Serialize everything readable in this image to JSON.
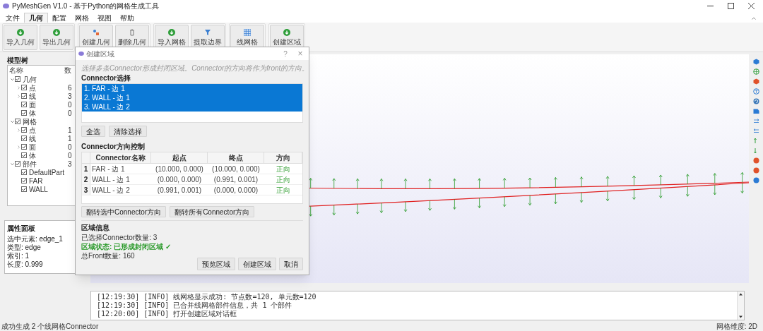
{
  "window": {
    "title": "PyMeshGen V1.0 - 基于Python的网格生成工具"
  },
  "menu": [
    {
      "label": "文件",
      "selected": false
    },
    {
      "label": "几何",
      "selected": true
    },
    {
      "label": "配置",
      "selected": false
    },
    {
      "label": "网格",
      "selected": false
    },
    {
      "label": "视图",
      "selected": false
    },
    {
      "label": "帮助",
      "selected": false
    }
  ],
  "toolbar": [
    {
      "buttons": [
        {
          "label": "导入几何",
          "kind": "import"
        },
        {
          "label": "导出几何",
          "kind": "import"
        }
      ]
    },
    {
      "buttons": [
        {
          "label": "创建几何",
          "kind": "shape"
        },
        {
          "label": "删除几何",
          "kind": "trash"
        }
      ]
    },
    {
      "buttons": [
        {
          "label": "导入网格",
          "kind": "import"
        },
        {
          "label": "提取边界",
          "kind": "filter"
        }
      ]
    },
    {
      "buttons": [
        {
          "label": "线网格",
          "kind": "grid"
        }
      ]
    },
    {
      "buttons": [
        {
          "label": "创建区域",
          "kind": "import"
        }
      ]
    }
  ],
  "model_tree": {
    "title": "模型树",
    "columns": [
      "名称",
      "数"
    ],
    "items": [
      {
        "label": "几何",
        "checked": true,
        "expanded": true,
        "children": [
          {
            "label": "点",
            "value": "6",
            "checked": true,
            "expanded": false
          },
          {
            "label": "线",
            "value": "3",
            "checked": true,
            "expanded": false
          },
          {
            "label": "面",
            "value": "0",
            "checked": true
          },
          {
            "label": "体",
            "value": "0",
            "checked": true
          }
        ]
      },
      {
        "label": "网格",
        "checked": true,
        "expanded": true,
        "children": [
          {
            "label": "点",
            "value": "1",
            "checked": true,
            "expanded": false
          },
          {
            "label": "线",
            "value": "1",
            "checked": true
          },
          {
            "label": "面",
            "value": "0",
            "checked": true,
            "expanded": false
          },
          {
            "label": "体",
            "value": "0",
            "checked": true
          }
        ]
      },
      {
        "label": "部件",
        "value": "3",
        "checked": true,
        "expanded": true,
        "children": [
          {
            "label": "DefaultPart",
            "checked": true
          },
          {
            "label": "FAR",
            "checked": true
          },
          {
            "label": "WALL",
            "checked": true
          }
        ]
      }
    ]
  },
  "properties": {
    "title": "属性面板",
    "lines": [
      "选中元素: edge_1",
      "类型: edge",
      "索引: 1",
      "长度: 0.999"
    ]
  },
  "log": {
    "lines": [
      "[12:19:30] [INFO] 线网格显示成功: 节点数=120, 单元数=120",
      "[12:19:30] [INFO] 已合并线网格部件信息，共 1 个部件",
      "[12:20:00] [INFO] 打开创建区域对话框"
    ]
  },
  "status_bar": {
    "message": "成功生成 2 个线网格Connector",
    "dimension": "网格维度: 2D"
  },
  "dialog": {
    "title": "创建区域",
    "help": "?",
    "close": "×",
    "description": "选择多条Connector形成封闭区域。Connector的方向将作为front的方向。",
    "selection_title": "Connector选择",
    "connectors": [
      {
        "label": "1. FAR - 边 1",
        "selected": true
      },
      {
        "label": "2. WALL - 边 1",
        "selected": true
      },
      {
        "label": "3. WALL - 边 2",
        "selected": true
      }
    ],
    "selection_buttons": [
      "全选",
      "清除选择"
    ],
    "direction_title": "Connector方向控制",
    "table": {
      "columns": [
        "Connector名称",
        "起点",
        "终点",
        "方向"
      ],
      "rows": [
        {
          "index": "1",
          "name": "FAR - 边 1",
          "start": "(10.000, 0.000)",
          "end": "(10.000, 0.000)",
          "direction": "正向"
        },
        {
          "index": "2",
          "name": "WALL - 边 1",
          "start": "(0.000, 0.000)",
          "end": "(0.991, 0.001)",
          "direction": "正向"
        },
        {
          "index": "3",
          "name": "WALL - 边 2",
          "start": "(0.991, 0.001)",
          "end": "(0.000, 0.000)",
          "direction": "正向"
        }
      ]
    },
    "flip_buttons": [
      "翻转选中Connector方向",
      "翻转所有Connector方向"
    ],
    "info_title": "区域信息",
    "info": {
      "count": "已选择Connector数量: 3",
      "status": "区域状态: 已形成封闭区域 ✓",
      "fronts": "总Front数量: 160"
    },
    "footer_buttons": [
      "预览区域",
      "创建区域",
      "取消"
    ]
  }
}
